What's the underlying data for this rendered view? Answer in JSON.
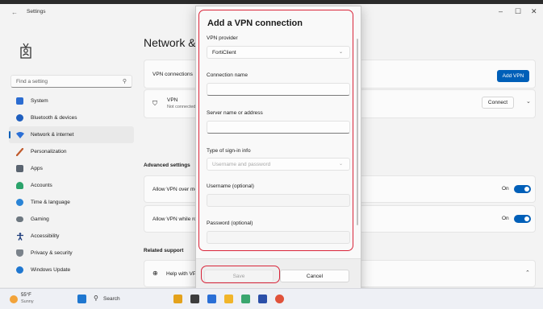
{
  "window": {
    "title": "Settings",
    "back_icon": "←",
    "controls": {
      "minimize": "–",
      "maximize": "☐",
      "close": "✕"
    }
  },
  "sidebar": {
    "search_placeholder": "Find a setting",
    "items": [
      {
        "label": "System",
        "icon": "monitor-icon",
        "color": "#2b6cd1"
      },
      {
        "label": "Bluetooth & devices",
        "icon": "bluetooth-icon",
        "color": "#1f5fbf"
      },
      {
        "label": "Network & internet",
        "icon": "wifi-icon",
        "color": "#2a6fd6",
        "active": true
      },
      {
        "label": "Personalization",
        "icon": "brush-icon",
        "color": "#c05a2c"
      },
      {
        "label": "Apps",
        "icon": "apps-icon",
        "color": "#5a6470"
      },
      {
        "label": "Accounts",
        "icon": "person-icon",
        "color": "#2ba36b"
      },
      {
        "label": "Time & language",
        "icon": "globe-clock-icon",
        "color": "#2a84d6"
      },
      {
        "label": "Gaming",
        "icon": "gamepad-icon",
        "color": "#6d7780"
      },
      {
        "label": "Accessibility",
        "icon": "accessibility-icon",
        "color": "#1b3a7a"
      },
      {
        "label": "Privacy & security",
        "icon": "shield-icon",
        "color": "#7b838b"
      },
      {
        "label": "Windows Update",
        "icon": "update-icon",
        "color": "#1f77d0"
      }
    ]
  },
  "main": {
    "page_title": "Network & internet > VPN",
    "vpn_connections_label": "VPN connections",
    "add_vpn_label": "Add VPN",
    "vpn_item": {
      "name": "VPN",
      "status": "Not connected",
      "connect_label": "Connect"
    },
    "advanced_settings_label": "Advanced settings",
    "allow_metered_label": "Allow VPN over metered networks",
    "allow_metered_state": "On",
    "allow_roaming_label": "Allow VPN while roaming",
    "allow_roaming_state": "On",
    "related_support_label": "Related support",
    "help_item_label": "Help with VPN"
  },
  "dialog": {
    "title": "Add a VPN connection",
    "vpn_provider_label": "VPN provider",
    "vpn_provider_value": "FortiClient",
    "connection_name_label": "Connection name",
    "connection_name_value": "",
    "server_label": "Server name or address",
    "server_value": "",
    "signin_type_label": "Type of sign-in info",
    "signin_type_value": "Username and password",
    "username_label": "Username (optional)",
    "username_value": "",
    "password_label": "Password (optional)",
    "password_value": "",
    "save_label": "Save",
    "cancel_label": "Cancel"
  },
  "taskbar": {
    "weather_temp": "55°F",
    "weather_condition": "Sunny",
    "search_label": "Search"
  },
  "colors": {
    "accent": "#005fb8",
    "highlight_ring": "#d9253a"
  }
}
